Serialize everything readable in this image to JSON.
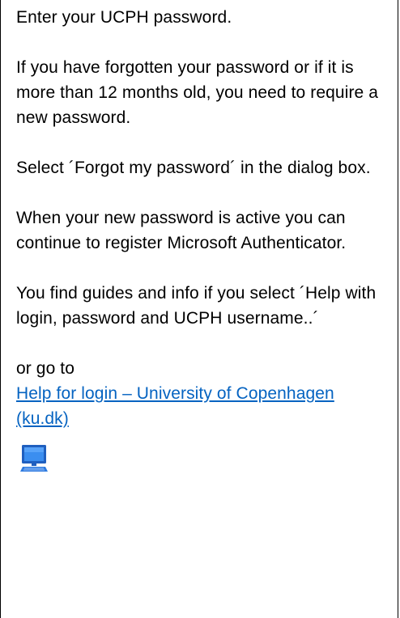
{
  "instructions": {
    "p1": "Enter your UCPH password.",
    "p2": "If you have forgotten your password or if it is more than 12 months old, you need to require a new password.",
    "p3": "Select ´Forgot my password´ in the dialog box.",
    "p4": "When your new password is active you can continue to register Microsoft Authenticator.",
    "p5": "You find guides and info if you select ´Help with login, password and UCPH username..´",
    "p6": "or go to",
    "link_text": "Help for login – University of Copenhagen (ku.dk)"
  },
  "colors": {
    "link": "#0563c1",
    "border": "#000000",
    "icon": "#1f6fd1"
  },
  "icons": {
    "computer": "computer-icon"
  }
}
